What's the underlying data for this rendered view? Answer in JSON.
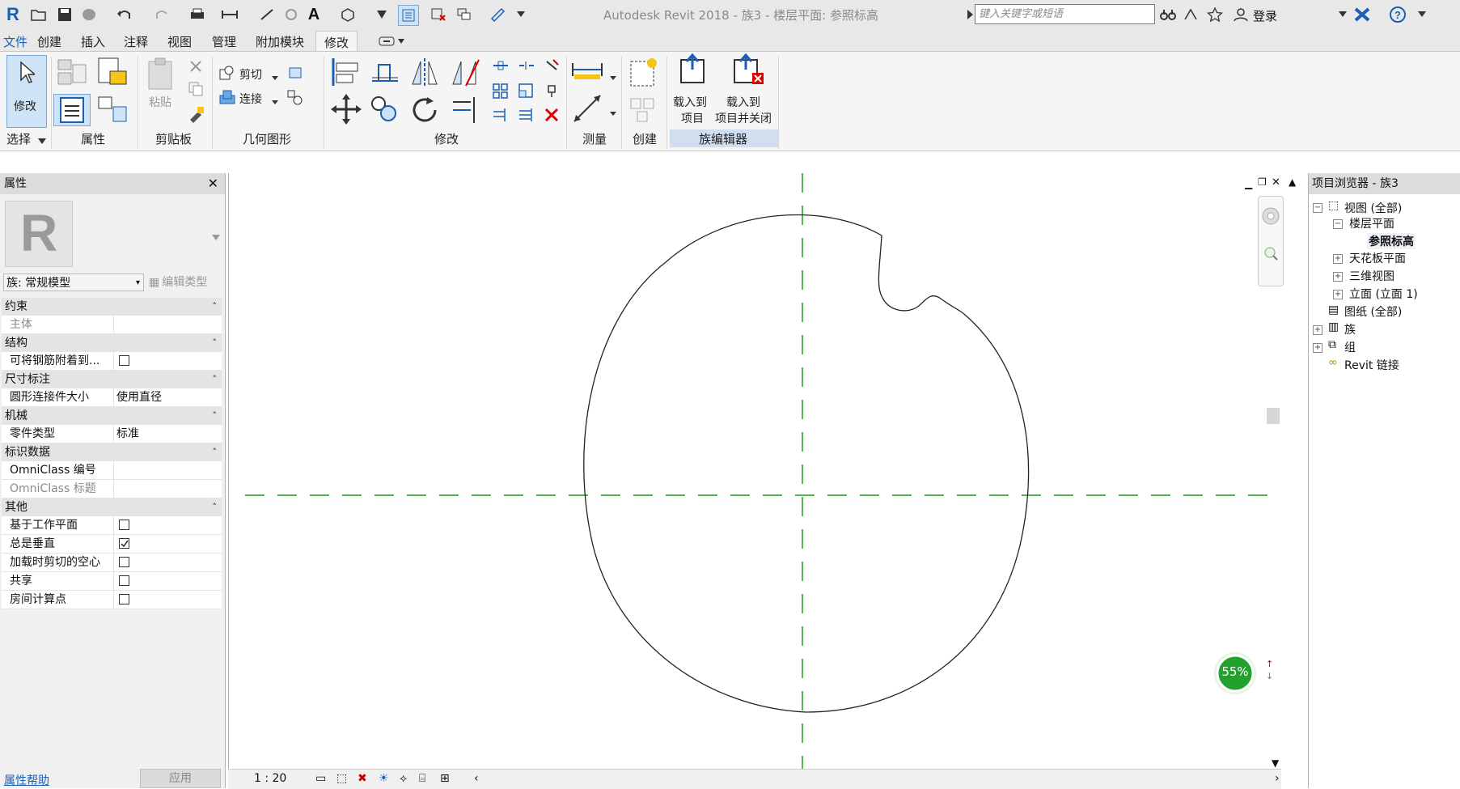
{
  "app": {
    "title": "Autodesk Revit 2018 -    族3 - 楼层平面: 参照标高",
    "search_placeholder": "键入关键字或短语",
    "login": "登录",
    "brand_color": "#1b5fb5"
  },
  "menu": {
    "tabs": [
      "文件",
      "创建",
      "插入",
      "注释",
      "视图",
      "管理",
      "附加模块",
      "修改"
    ],
    "active": "修改"
  },
  "ribbon": {
    "modify_label": "修改",
    "select_label": "选择",
    "properties_label": "属性",
    "paste_label": "粘贴",
    "clipboard_label": "剪贴板",
    "cut_label": "剪切",
    "join_label": "连接",
    "geometry_label": "几何图形",
    "modify_panel_label": "修改",
    "measure_label": "测量",
    "create_label": "创建",
    "load_into_project_1": "载入到",
    "load_into_project_2": "项目",
    "load_close_1": "载入到",
    "load_close_2": "项目并关闭",
    "family_editor_label": "族编辑器"
  },
  "properties": {
    "header": "属性",
    "type_selector": "族: 常规模型",
    "edit_type": "编辑类型",
    "help_link": "属性帮助",
    "apply": "应用",
    "categories": [
      {
        "name": "约束",
        "rows": [
          {
            "k": "主体",
            "v": "",
            "disabled": true
          }
        ]
      },
      {
        "name": "结构",
        "rows": [
          {
            "k": "可将钢筋附着到...",
            "checkbox": false
          }
        ]
      },
      {
        "name": "尺寸标注",
        "rows": [
          {
            "k": "圆形连接件大小",
            "v": "使用直径"
          }
        ]
      },
      {
        "name": "机械",
        "rows": [
          {
            "k": "零件类型",
            "v": "标准"
          }
        ]
      },
      {
        "name": "标识数据",
        "rows": [
          {
            "k": "OmniClass 编号",
            "v": ""
          },
          {
            "k": "OmniClass 标题",
            "v": "",
            "disabled": true
          }
        ]
      },
      {
        "name": "其他",
        "rows": [
          {
            "k": "基于工作平面",
            "checkbox": false
          },
          {
            "k": "总是垂直",
            "checkbox": true
          },
          {
            "k": "加载时剪切的空心",
            "checkbox": false
          },
          {
            "k": "共享",
            "checkbox": false
          },
          {
            "k": "房间计算点",
            "checkbox": false
          }
        ]
      }
    ]
  },
  "browser": {
    "header": "项目浏览器 - 族3",
    "items": [
      "视图 (全部)",
      "楼层平面",
      "参照标高",
      "天花板平面",
      "三维视图",
      "立面 (立面 1)",
      "图纸 (全部)",
      "族",
      "组",
      "Revit 链接"
    ]
  },
  "canvas": {
    "scale": "1 : 20",
    "progress_percent": 55,
    "progress_label": "55%"
  }
}
